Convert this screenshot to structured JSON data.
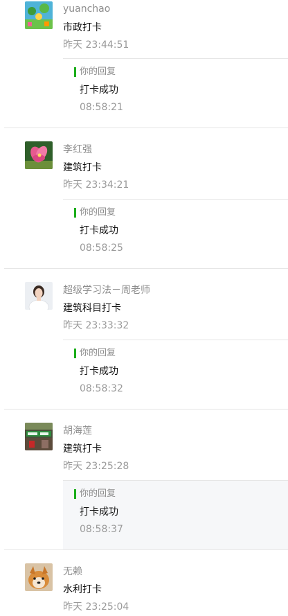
{
  "reply_label": "你的回复",
  "accent_color": "#1aad19",
  "messages": [
    {
      "user": "yuanchao",
      "text": "市政打卡",
      "time": "昨天 23:44:51",
      "avatar_icon": "avatar-garden-icon",
      "reply": {
        "text": "打卡成功",
        "time": "08:58:21"
      }
    },
    {
      "user": "李红强",
      "text": "建筑打卡",
      "time": "昨天 23:34:21",
      "avatar_icon": "avatar-flower-icon",
      "reply": {
        "text": "打卡成功",
        "time": "08:58:25"
      }
    },
    {
      "user": "超级学习法－周老师",
      "text": "建筑科目打卡",
      "time": "昨天 23:33:32",
      "avatar_icon": "avatar-portrait-icon",
      "reply": {
        "text": "打卡成功",
        "time": "08:58:32"
      }
    },
    {
      "user": "胡海莲",
      "text": "建筑打卡",
      "time": "昨天 23:25:28",
      "avatar_icon": "avatar-street-icon",
      "reply": {
        "text": "打卡成功",
        "time": "08:58:37"
      }
    },
    {
      "user": "无赖",
      "text": "水利打卡",
      "time": "昨天 23:25:04",
      "avatar_icon": "avatar-dog-icon"
    }
  ]
}
